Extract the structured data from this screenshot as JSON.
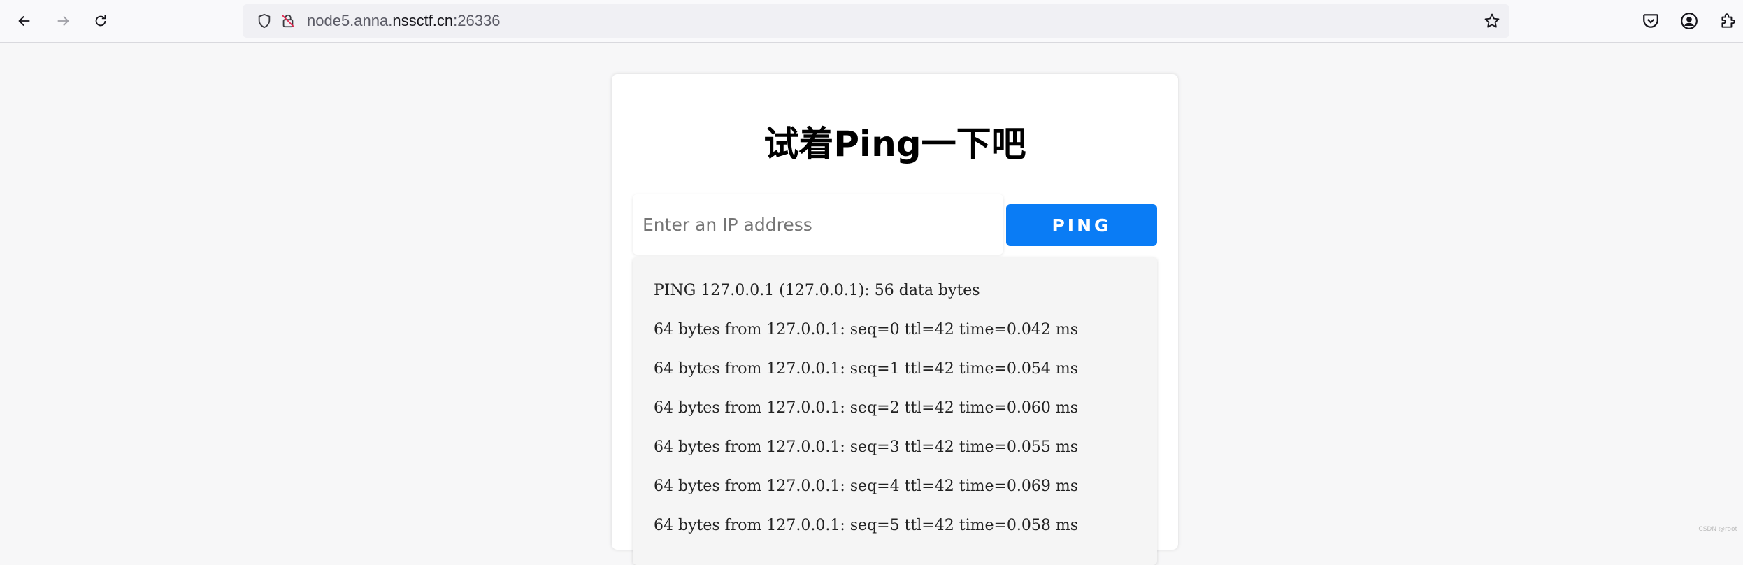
{
  "browser": {
    "url_prefix": "node5.anna.",
    "url_host": "nssctf.cn",
    "url_port": ":26336"
  },
  "page": {
    "title": "试着Ping一下吧",
    "ip_placeholder": "Enter an IP address",
    "ping_label": "PING",
    "output_lines": [
      "PING 127.0.0.1 (127.0.0.1): 56 data bytes",
      "64 bytes from 127.0.0.1: seq=0 ttl=42 time=0.042 ms",
      "64 bytes from 127.0.0.1: seq=1 ttl=42 time=0.054 ms",
      "64 bytes from 127.0.0.1: seq=2 ttl=42 time=0.060 ms",
      "64 bytes from 127.0.0.1: seq=3 ttl=42 time=0.055 ms",
      "64 bytes from 127.0.0.1: seq=4 ttl=42 time=0.069 ms",
      "64 bytes from 127.0.0.1: seq=5 ttl=42 time=0.058 ms"
    ]
  },
  "watermark": "CSDN @root",
  "colors": {
    "accent": "#0a7cf5",
    "page_bg": "#f7f7f8"
  },
  "icons": [
    "back-arrow-icon",
    "forward-arrow-icon",
    "reload-icon",
    "shield-icon",
    "lock-slash-icon",
    "star-icon",
    "pocket-icon",
    "account-icon",
    "extensions-icon"
  ]
}
